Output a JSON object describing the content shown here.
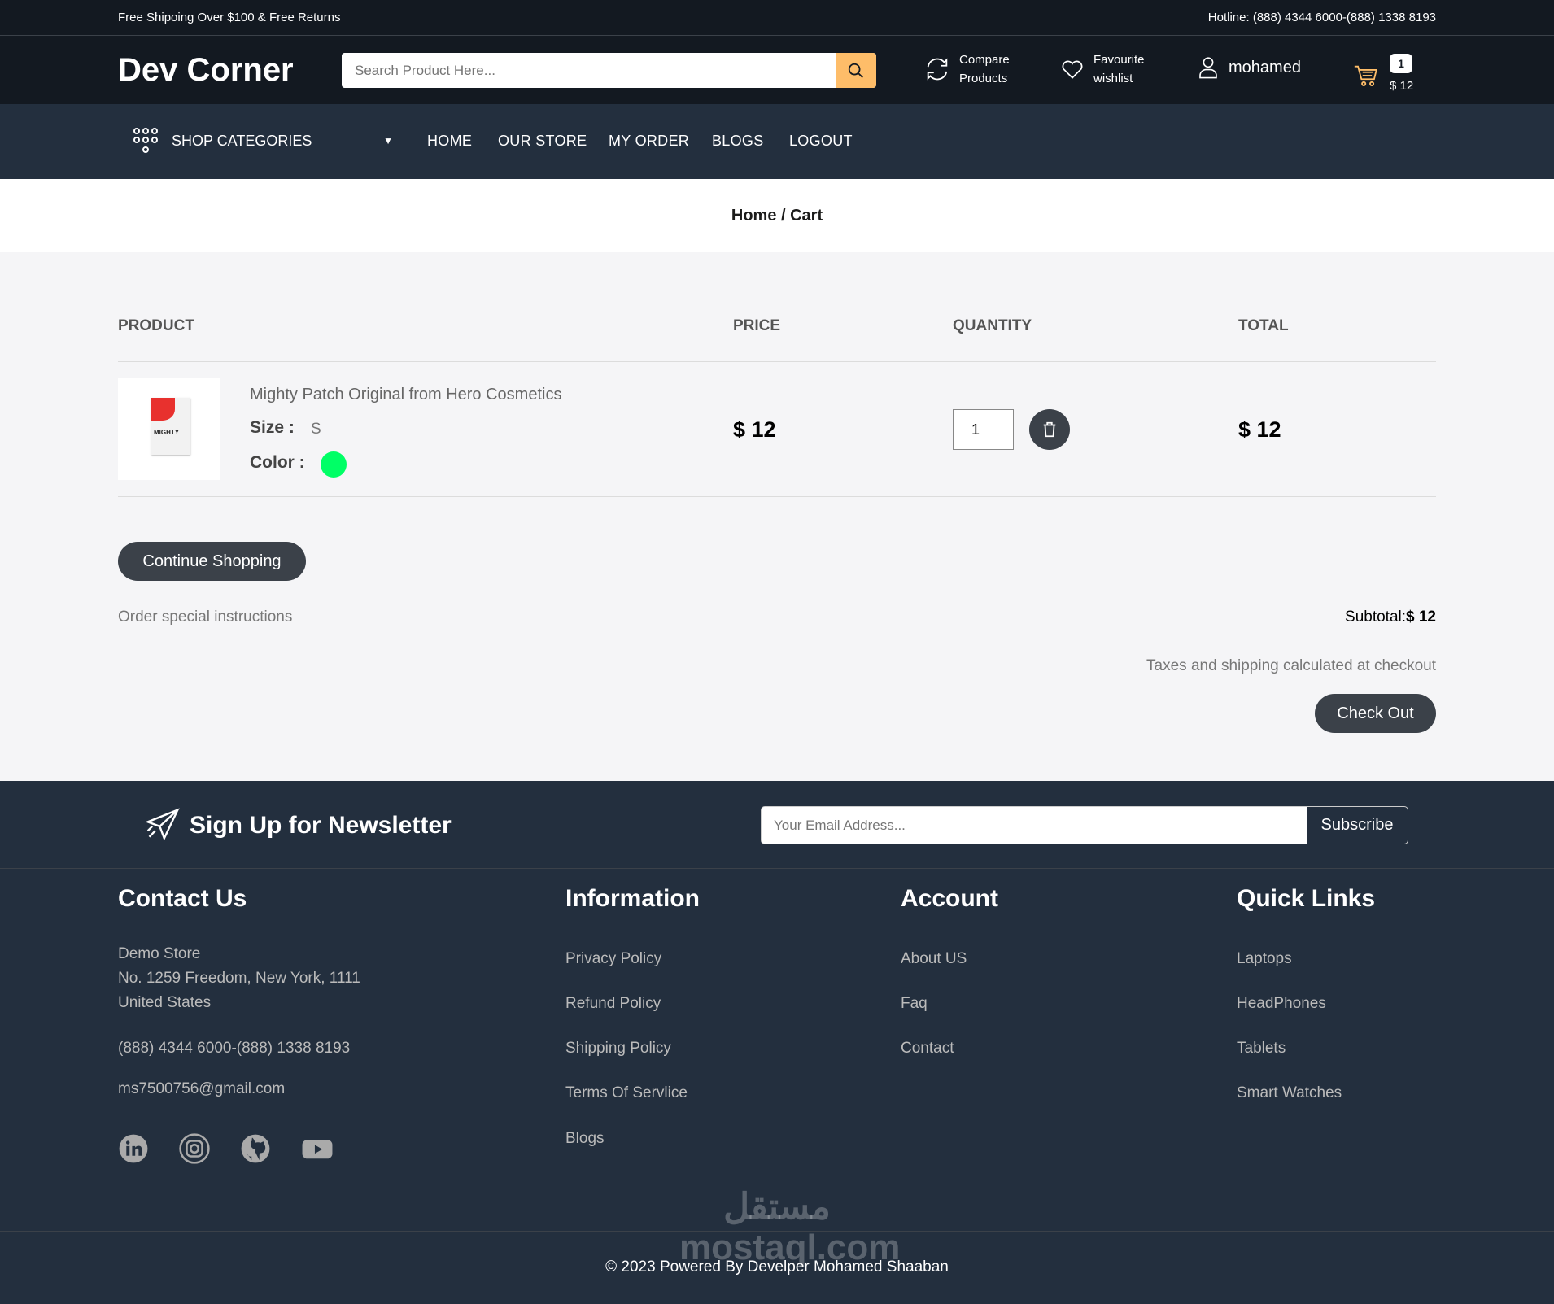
{
  "topbar": {
    "left": "Free Shipoing Over $100 & Free Returns",
    "right": "Hotline: (888) 4344 6000-(888) 1338 8193"
  },
  "header": {
    "logo": "Dev Corner",
    "search_placeholder": "Search Product Here...",
    "compare": [
      "Compare",
      "Products"
    ],
    "wishlist": [
      "Favourite",
      "wishlist"
    ],
    "user": "mohamed",
    "cart_count": "1",
    "cart_total": "$ 12"
  },
  "nav": {
    "categories": "SHOP CATEGORIES",
    "links": [
      "HOME",
      "OUR STORE",
      "MY ORDER",
      "BLOGS",
      "LOGOUT"
    ]
  },
  "breadcrumb": "Home / Cart",
  "cart": {
    "headers": [
      "PRODUCT",
      "PRICE",
      "QUANTITY",
      "TOTAL"
    ],
    "item": {
      "name": "Mighty Patch Original from Hero Cosmetics",
      "size_label": "Size :",
      "size": "S",
      "color_label": "Color :",
      "color": "#00ff66",
      "price": "$ 12",
      "quantity": "1",
      "total": "$ 12",
      "image_text": "MIGHTY"
    },
    "continue": "Continue Shopping",
    "instructions": "Order special instructions",
    "subtotal_label": "Subtotal:",
    "subtotal": "$ 12",
    "taxes": "Taxes and shipping calculated at checkout",
    "checkout": "Check Out"
  },
  "footer": {
    "newsletter": "Sign Up for Newsletter",
    "email_placeholder": "Your Email Address...",
    "subscribe": "Subscribe",
    "contact": {
      "title": "Contact Us",
      "address": [
        "Demo Store",
        "No. 1259 Freedom, New York, 1111",
        "United States"
      ],
      "phone": "(888) 4344 6000-(888) 1338 8193",
      "email": "ms7500756@gmail.com"
    },
    "information": {
      "title": "Information",
      "links": [
        "Privacy Policy",
        "Refund Policy",
        "Shipping Policy",
        "Terms Of Servlice",
        "Blogs"
      ]
    },
    "account": {
      "title": "Account",
      "links": [
        "About US",
        "Faq",
        "Contact"
      ]
    },
    "quick": {
      "title": "Quick Links",
      "links": [
        "Laptops",
        "HeadPhones",
        "Tablets",
        "Smart Watches"
      ]
    },
    "copyright": "© 2023 Powered By Develper Mohamed Shaaban",
    "watermark": "مستقل mostaql.com"
  }
}
